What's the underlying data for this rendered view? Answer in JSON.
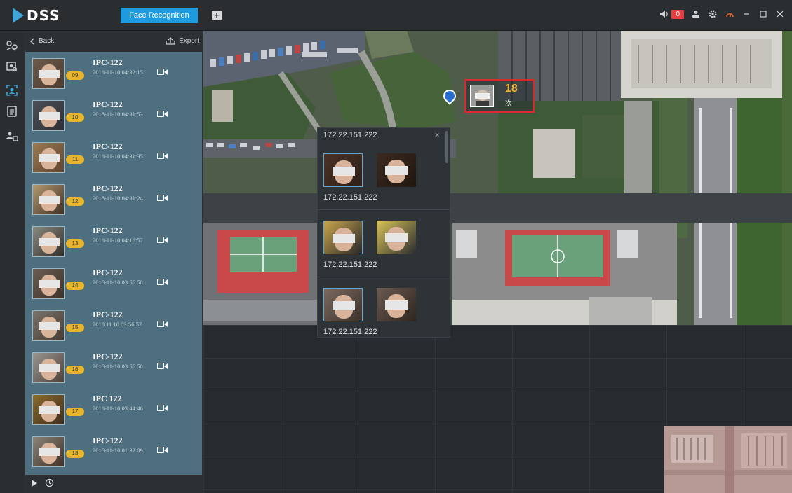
{
  "app": {
    "logo_text": "DSS",
    "active_tab": "Face Recognition",
    "add_tab_icon": "plus-icon",
    "alarm_count": "0",
    "colors": {
      "accent": "#1d9bde",
      "badge": "#e8b42b",
      "alarm": "#e34040",
      "highlight": "#d82b2b"
    }
  },
  "left_nav": {
    "items": [
      {
        "icon": "map-route-icon"
      },
      {
        "icon": "face-search-icon"
      },
      {
        "icon": "face-recognition-icon",
        "active": true
      },
      {
        "icon": "report-icon"
      },
      {
        "icon": "person-list-icon"
      }
    ]
  },
  "panel": {
    "back_label": "Back",
    "export_label": "Export",
    "records": [
      {
        "index": "09",
        "name": "IPC-122",
        "time": "2018-11-10 04:32:15"
      },
      {
        "index": "10",
        "name": "IPC-122",
        "time": "2018-11-10 04:31:53"
      },
      {
        "index": "11",
        "name": "IPC-122",
        "time": "2018-11-10 04:31:35"
      },
      {
        "index": "12",
        "name": "IPC-122",
        "time": "2018-11-10 04:31:24"
      },
      {
        "index": "13",
        "name": "IPC-122",
        "time": "2018-11-10 04:16:57"
      },
      {
        "index": "14",
        "name": "IPC-122",
        "time": "2018-11-10 03:56:58"
      },
      {
        "index": "15",
        "name": "IPC-122",
        "time": "2018 11 10 03:56:57"
      },
      {
        "index": "16",
        "name": "IPC-122",
        "time": "2018-11-10 03:56:50"
      },
      {
        "index": "17",
        "name": "IPC 122",
        "time": "2018-11-10 03:44:46"
      },
      {
        "index": "18",
        "name": "IPC-122",
        "time": "2018-11-10 01:32:09"
      }
    ]
  },
  "map": {
    "marker": {
      "count": "18",
      "unit": "次"
    }
  },
  "popup": {
    "title": "172.22.151.222",
    "close_icon": "close-icon",
    "groups": [
      {
        "ip": "172.22.151.222"
      },
      {
        "ip": "172.22.151.222"
      },
      {
        "ip": "172.22.151.222"
      }
    ]
  }
}
